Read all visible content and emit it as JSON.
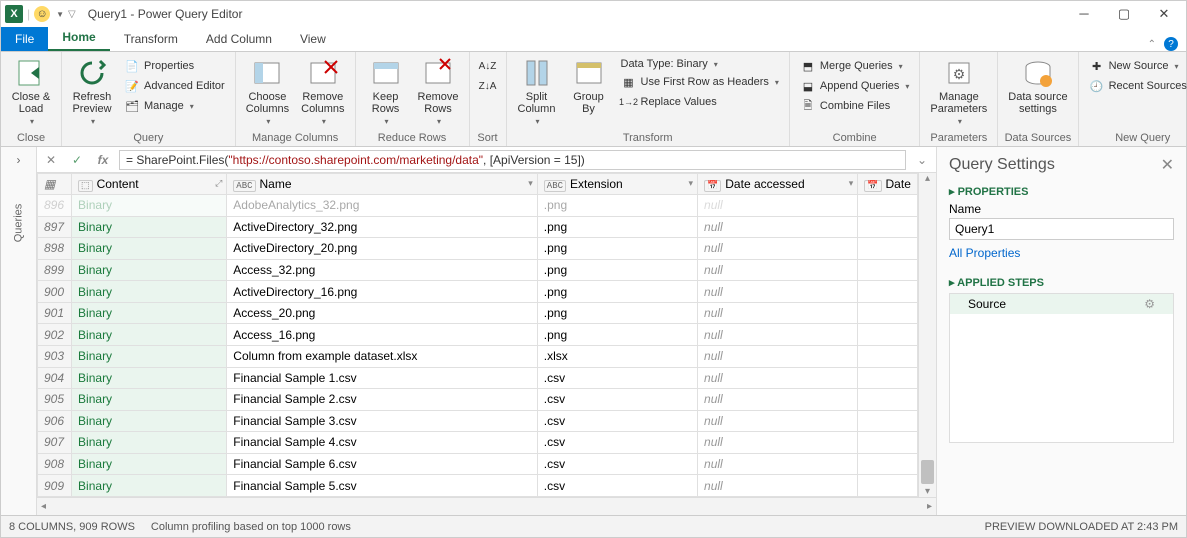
{
  "titlebar": {
    "title": "Query1 - Power Query Editor"
  },
  "tabs": {
    "file": "File",
    "home": "Home",
    "transform": "Transform",
    "addcolumn": "Add Column",
    "view": "View"
  },
  "ribbon": {
    "close": {
      "close_load": "Close &\nLoad",
      "group": "Close"
    },
    "query": {
      "refresh": "Refresh\nPreview",
      "properties": "Properties",
      "editor": "Advanced Editor",
      "manage": "Manage",
      "group": "Query"
    },
    "mc": {
      "choose": "Choose\nColumns",
      "remove": "Remove\nColumns",
      "group": "Manage Columns"
    },
    "rr": {
      "keep": "Keep\nRows",
      "remove": "Remove\nRows",
      "group": "Reduce Rows"
    },
    "sort": {
      "group": "Sort"
    },
    "transform": {
      "split": "Split\nColumn",
      "groupby": "Group\nBy",
      "datatype": "Data Type: Binary",
      "firstrow": "Use First Row as Headers",
      "replace": "Replace Values",
      "group": "Transform"
    },
    "combine": {
      "merge": "Merge Queries",
      "append": "Append Queries",
      "files": "Combine Files",
      "group": "Combine"
    },
    "params": {
      "label": "Manage\nParameters",
      "group": "Parameters"
    },
    "ds": {
      "label": "Data source\nsettings",
      "group": "Data Sources"
    },
    "nq": {
      "new": "New Source",
      "recent": "Recent Sources",
      "group": "New Query"
    }
  },
  "queries_rail": "Queries",
  "formula": {
    "prefix": "= SharePoint.Files(",
    "url": "\"https://contoso.sharepoint.com/marketing/data\"",
    "suffix": ", [ApiVersion = 15])"
  },
  "columns": {
    "content": "Content",
    "name": "Name",
    "extension": "Extension",
    "date_accessed": "Date accessed",
    "date": "Date"
  },
  "rows": [
    {
      "n": 896,
      "content": "Binary",
      "name": "AdobeAnalytics_32.png",
      "ext": ".png",
      "date": "null"
    },
    {
      "n": 897,
      "content": "Binary",
      "name": "ActiveDirectory_32.png",
      "ext": ".png",
      "date": "null"
    },
    {
      "n": 898,
      "content": "Binary",
      "name": "ActiveDirectory_20.png",
      "ext": ".png",
      "date": "null"
    },
    {
      "n": 899,
      "content": "Binary",
      "name": "Access_32.png",
      "ext": ".png",
      "date": "null"
    },
    {
      "n": 900,
      "content": "Binary",
      "name": "ActiveDirectory_16.png",
      "ext": ".png",
      "date": "null"
    },
    {
      "n": 901,
      "content": "Binary",
      "name": "Access_20.png",
      "ext": ".png",
      "date": "null"
    },
    {
      "n": 902,
      "content": "Binary",
      "name": "Access_16.png",
      "ext": ".png",
      "date": "null"
    },
    {
      "n": 903,
      "content": "Binary",
      "name": "Column from example dataset.xlsx",
      "ext": ".xlsx",
      "date": "null"
    },
    {
      "n": 904,
      "content": "Binary",
      "name": "Financial Sample 1.csv",
      "ext": ".csv",
      "date": "null"
    },
    {
      "n": 905,
      "content": "Binary",
      "name": "Financial Sample 2.csv",
      "ext": ".csv",
      "date": "null"
    },
    {
      "n": 906,
      "content": "Binary",
      "name": "Financial Sample 3.csv",
      "ext": ".csv",
      "date": "null"
    },
    {
      "n": 907,
      "content": "Binary",
      "name": "Financial Sample 4.csv",
      "ext": ".csv",
      "date": "null"
    },
    {
      "n": 908,
      "content": "Binary",
      "name": "Financial Sample 6.csv",
      "ext": ".csv",
      "date": "null"
    },
    {
      "n": 909,
      "content": "Binary",
      "name": "Financial Sample 5.csv",
      "ext": ".csv",
      "date": "null"
    }
  ],
  "settings": {
    "title": "Query Settings",
    "properties": "PROPERTIES",
    "name_label": "Name",
    "name_value": "Query1",
    "all_props": "All Properties",
    "applied": "APPLIED STEPS",
    "step": "Source"
  },
  "status": {
    "cols": "8 COLUMNS, 909 ROWS",
    "profiling": "Column profiling based on top 1000 rows",
    "preview": "PREVIEW DOWNLOADED AT 2:43 PM"
  }
}
